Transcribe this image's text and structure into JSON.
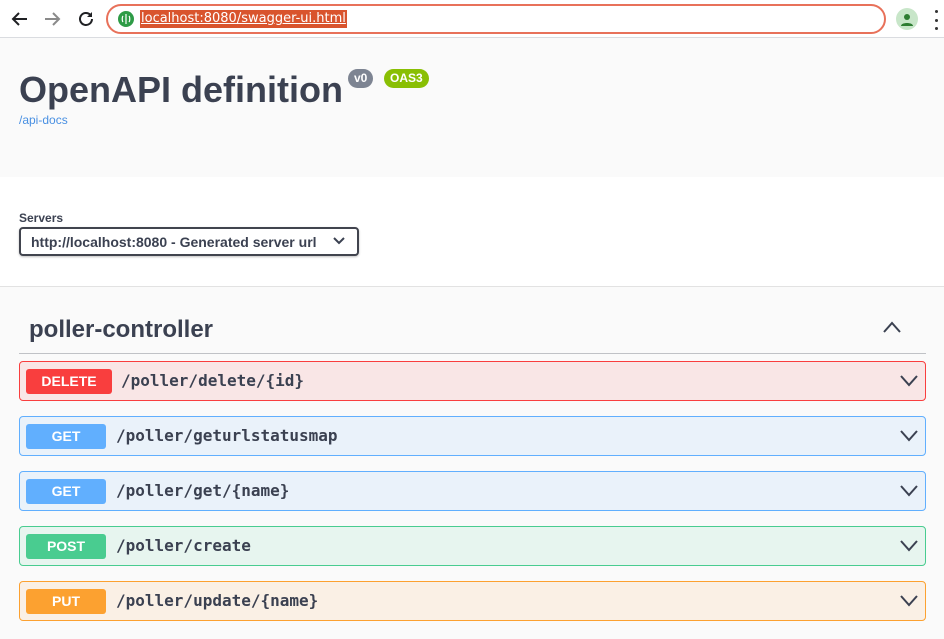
{
  "browser": {
    "url": "localhost:8080/swagger-ui.html"
  },
  "info": {
    "title": "OpenAPI definition",
    "version_badge": "v0",
    "oas_badge": "OAS3",
    "api_docs_link": "/api-docs"
  },
  "servers": {
    "label": "Servers",
    "selected": "http://localhost:8080 - Generated server url"
  },
  "tag": {
    "name": "poller-controller",
    "operations": [
      {
        "method": "DELETE",
        "path": "/poller/delete/{id}",
        "color": "#f93e3e"
      },
      {
        "method": "GET",
        "path": "/poller/geturlstatusmap",
        "color": "#61affe"
      },
      {
        "method": "GET",
        "path": "/poller/get/{name}",
        "color": "#61affe"
      },
      {
        "method": "POST",
        "path": "/poller/create",
        "color": "#49cc90"
      },
      {
        "method": "PUT",
        "path": "/poller/update/{name}",
        "color": "#fca130"
      }
    ]
  },
  "icons": {
    "back": "arrow-left-icon",
    "forward": "arrow-right-icon",
    "reload": "reload-icon",
    "site": "site-info-icon",
    "profile": "profile-icon",
    "menu": "kebab-menu-icon",
    "collapse": "chevron-up-icon",
    "expand": "chevron-down-icon"
  }
}
